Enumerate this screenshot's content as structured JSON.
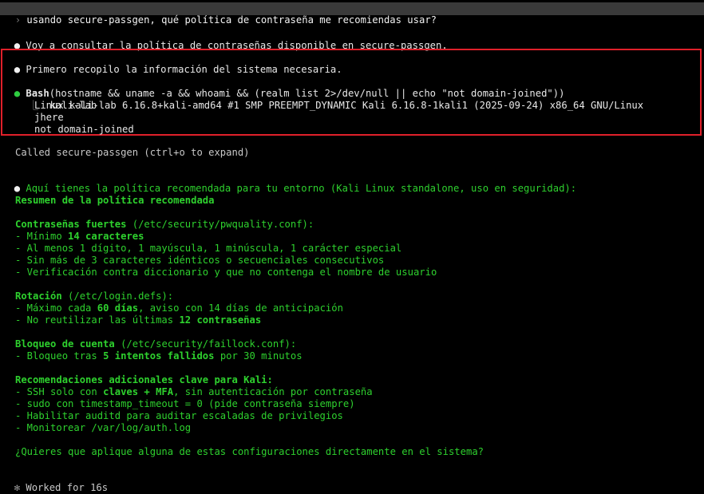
{
  "prompt": {
    "caret": "›",
    "text": "usando secure-passgen, qué política de contraseña me recomiendas usar?"
  },
  "msg1": {
    "bullet": "●",
    "text": "Voy a consultar la política de contraseñas disponible en secure-passgen."
  },
  "msg2": {
    "bullet": "●",
    "text": "Primero recopilo la información del sistema necesaria."
  },
  "bash": {
    "bullet": "●",
    "tool_name": "Bash",
    "command": "(hostname && uname -a && whoami && (realm list 2>/dev/null || echo \"not domain-joined\"))",
    "tree_char": "⎿",
    "output": [
      "kali-lab",
      "Linux kali-lab 6.16.8+kali-amd64 #1 SMP PREEMPT_DYNAMIC Kali 6.16.8-1kali1 (2025-09-24) x86_64 GNU/Linux",
      "jhere",
      "not domain-joined"
    ]
  },
  "called": "Called secure-passgen (ctrl+o to expand)",
  "response": {
    "bullet": "●",
    "intro": "Aquí tienes la política recomendada para tu entorno (Kali Linux standalone, uso en seguridad):",
    "heading": "Resumen de la política recomendada",
    "s1": {
      "title": "Contraseñas fuertes",
      "path": " (/etc/security/pwquality.conf):",
      "i1_pre": "- Mínimo ",
      "i1_bold": "14 caracteres",
      "i2": "- Al menos 1 dígito, 1 mayúscula, 1 minúscula, 1 carácter especial",
      "i3": "- Sin más de 3 caracteres idénticos o secuenciales consecutivos",
      "i4": "- Verificación contra diccionario y que no contenga el nombre de usuario"
    },
    "s2": {
      "title": "Rotación",
      "path": " (/etc/login.defs):",
      "i1_pre": "- Máximo cada ",
      "i1_bold": "60 días",
      "i1_post": ", aviso con 14 días de anticipación",
      "i2_pre": "- No reutilizar las últimas ",
      "i2_bold": "12 contraseñas"
    },
    "s3": {
      "title": "Bloqueo de cuenta",
      "path": " (/etc/security/faillock.conf):",
      "i1_pre": "- Bloqueo tras ",
      "i1_bold": "5 intentos fallidos",
      "i1_post": " por 30 minutos"
    },
    "s4": {
      "title": "Recomendaciones adicionales clave para Kali:",
      "i1_pre": "- SSH solo con ",
      "i1_bold": "claves + MFA",
      "i1_post": ", sin autenticación por contraseña",
      "i2": "- sudo con timestamp_timeout = 0 (pide contraseña siempre)",
      "i3": "- Habilitar auditd para auditar escaladas de privilegios",
      "i4": "- Monitorear /var/log/auth.log"
    },
    "question": "¿Quieres que aplique alguna de estas configuraciones directamente en el sistema?"
  },
  "footer": {
    "star": "✻",
    "text": "Worked for 16s"
  },
  "colors": {
    "background": "#000000",
    "green": "#2ed12e",
    "highlight_border": "#e0202a",
    "prompt_bar": "#3a3a3a"
  }
}
